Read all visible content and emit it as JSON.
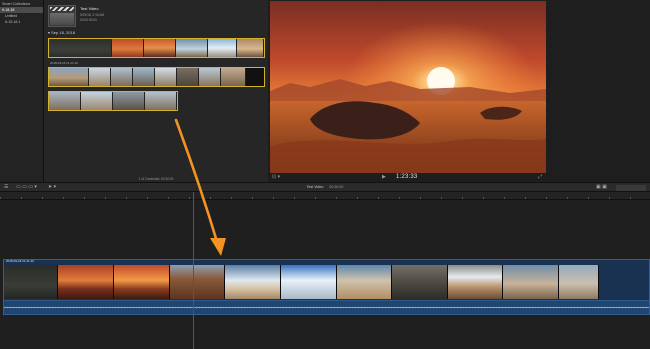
{
  "sidebar": {
    "items": [
      {
        "label": "Smart Collections",
        "selected": false,
        "indent": false
      },
      {
        "label": "9-18-18",
        "selected": true,
        "indent": false
      },
      {
        "label": "Untitled",
        "selected": false,
        "indent": true
      },
      {
        "label": "6-15-18.1",
        "selected": false,
        "indent": true
      }
    ]
  },
  "browser": {
    "project": {
      "title": "Test Video",
      "date": "9/19/18, 2:15 AM",
      "duration": "00:00:00:00"
    },
    "event_date": "Sep 18, 2018",
    "clip_timestamp": "2018-09-18 21.21.40",
    "status": "1 of 3 selected, 00:30:00"
  },
  "viewer": {
    "timecode": "1:23:33"
  },
  "timeline": {
    "title": "Test Video",
    "duration": "00:30:00",
    "clip_label": "2018-09-18 21.21.40"
  },
  "colors": {
    "accent_selection": "#d5b22c",
    "arrow": "#f29323",
    "storyline_blue": "#1a3252"
  },
  "icons": [
    "play-icon",
    "fullscreen-icon",
    "arrow-tool-icon",
    "snapping-icon",
    "index-icon"
  ]
}
